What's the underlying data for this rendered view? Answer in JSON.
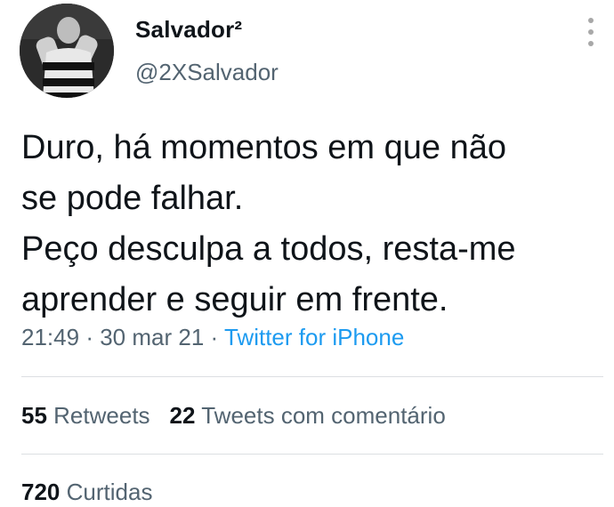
{
  "author": {
    "display_name": "Salvador²",
    "handle": "@2XSalvador"
  },
  "tweet": {
    "lines": [
      "Duro, há momentos em que não",
      "se pode falhar.",
      "Peço desculpa a todos, resta-me",
      "aprender e seguir em frente."
    ]
  },
  "meta": {
    "time": "21:49",
    "separator": "·",
    "date": "30 mar 21",
    "source": "Twitter for iPhone"
  },
  "stats": {
    "retweets_count": "55",
    "retweets_label": "Retweets",
    "quotes_count": "22",
    "quotes_label": "Tweets com comentário",
    "likes_count": "720",
    "likes_label": "Curtidas"
  },
  "icons": {
    "more": "more-vertical-icon"
  },
  "colors": {
    "text": "#0f1419",
    "secondary": "#536471",
    "link": "#1d9bf0",
    "divider": "#dcdfe2"
  }
}
